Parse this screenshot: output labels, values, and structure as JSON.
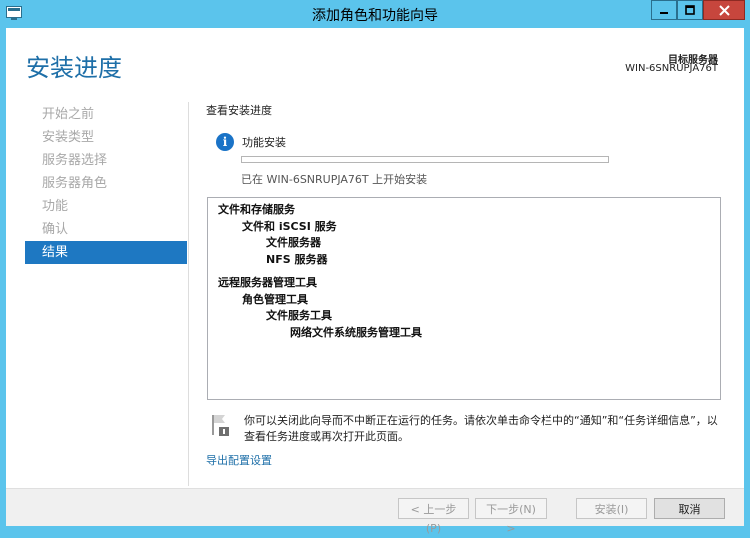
{
  "window": {
    "title": "添加角色和功能向导",
    "app_icon": "server-manager-icon",
    "controls": [
      "minimize-icon",
      "maximize-icon",
      "close-icon"
    ]
  },
  "header": {
    "title": "安装进度",
    "destination_label": "目标服务器",
    "destination_server": "WIN-6SNRUPJA76T"
  },
  "sidebar": {
    "items": [
      {
        "label": "开始之前",
        "active": false
      },
      {
        "label": "安装类型",
        "active": false
      },
      {
        "label": "服务器选择",
        "active": false
      },
      {
        "label": "服务器角色",
        "active": false
      },
      {
        "label": "功能",
        "active": false
      },
      {
        "label": "确认",
        "active": false
      },
      {
        "label": "结果",
        "active": true
      }
    ],
    "active_color": "#1e78c2"
  },
  "main": {
    "section_title": "查看安装进度",
    "step": {
      "icon": "info-icon",
      "name": "功能安装",
      "progress_percent": 0,
      "status": "已在 WIN-6SNRUPJA76T 上开始安装"
    },
    "results_tree": [
      {
        "level": 1,
        "label": "文件和存储服务",
        "group_start": true
      },
      {
        "level": 2,
        "label": "文件和 iSCSI 服务"
      },
      {
        "level": 3,
        "label": "文件服务器"
      },
      {
        "level": 3,
        "label": "NFS 服务器"
      },
      {
        "level": 1,
        "label": "远程服务器管理工具",
        "group_start": true
      },
      {
        "level": 2,
        "label": "角色管理工具"
      },
      {
        "level": 3,
        "label": "文件服务工具"
      },
      {
        "level": 4,
        "label": "网络文件系统服务管理工具"
      }
    ],
    "note": {
      "icon": "notification-flag-icon",
      "text": "你可以关闭此向导而不中断正在运行的任务。请依次单击命令栏中的“通知”和“任务详细信息”，以查看任务进度或再次打开此页面。"
    },
    "export_link": "导出配置设置"
  },
  "footer": {
    "prev_label": "< 上一步(P)",
    "next_label": "下一步(N) >",
    "install_label": "安装(I)",
    "cancel_label": "取消"
  },
  "colors": {
    "titlebar": "#5bc4ec",
    "heading": "#1e6fa8",
    "close_button": "#c7463d"
  }
}
